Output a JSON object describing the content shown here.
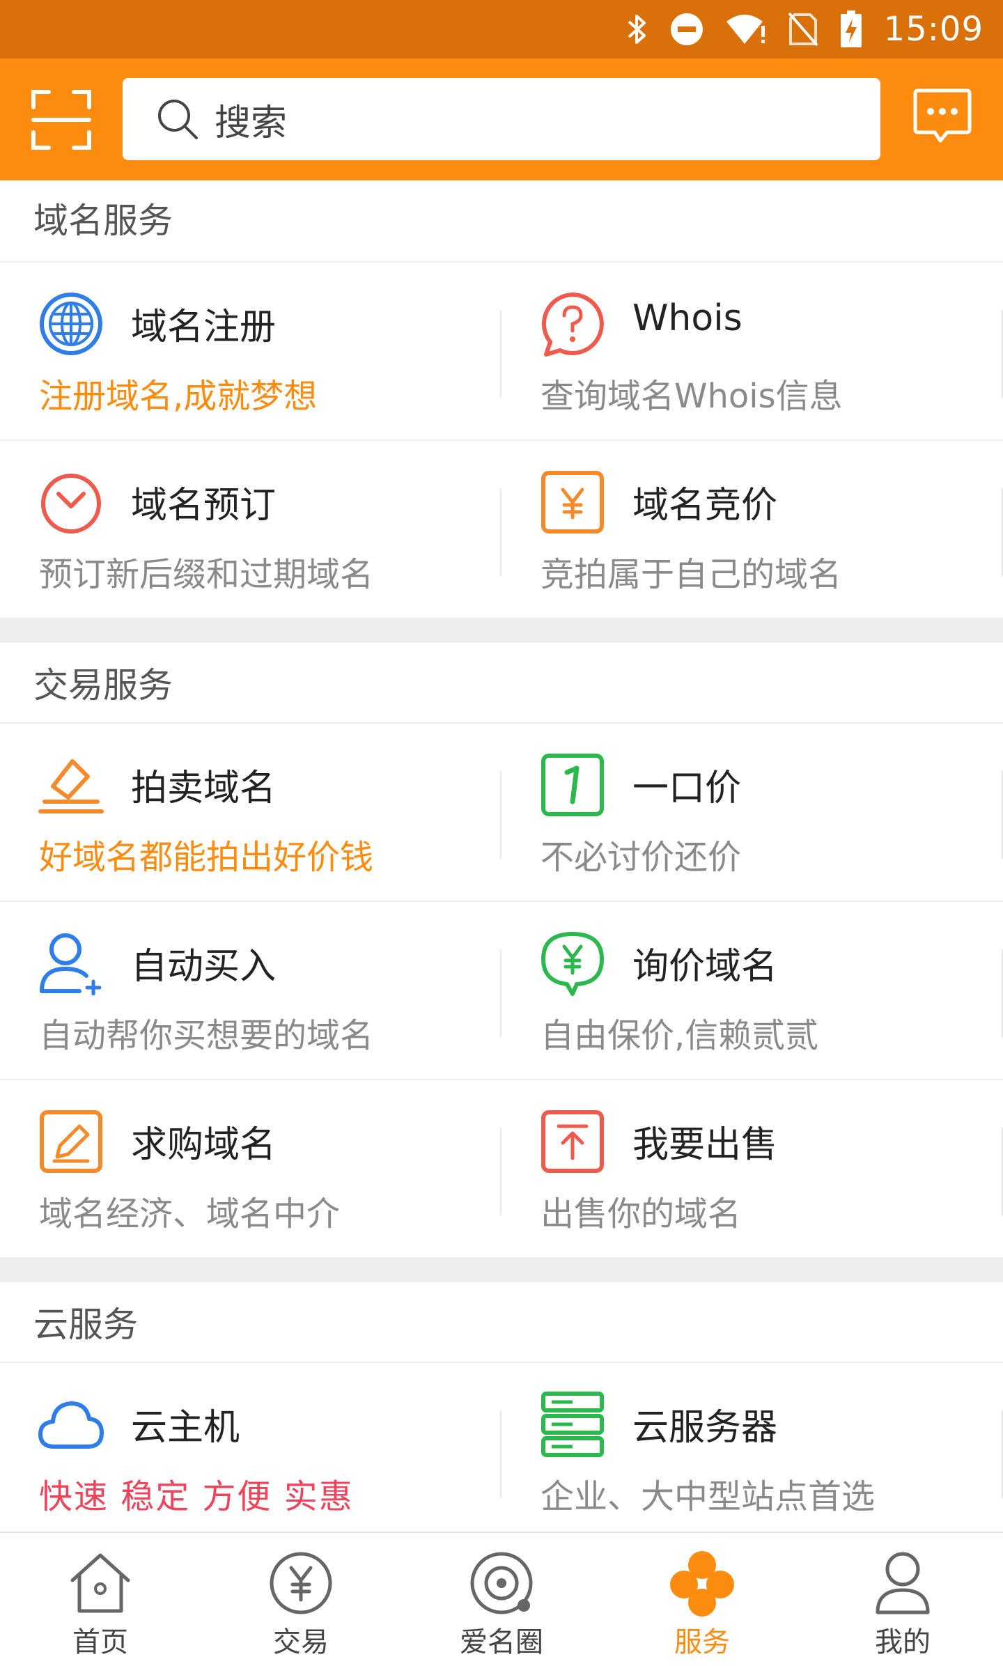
{
  "status_bar": {
    "time": "15:09"
  },
  "header": {
    "search_placeholder": "搜索"
  },
  "sections": {
    "domain": {
      "title": "域名服务",
      "items": [
        {
          "title": "域名注册",
          "desc": "注册域名,成就梦想"
        },
        {
          "title": "Whois",
          "desc": "查询域名Whois信息"
        },
        {
          "title": "域名预订",
          "desc": "预订新后缀和过期域名"
        },
        {
          "title": "域名竞价",
          "desc": "竞拍属于自己的域名"
        }
      ]
    },
    "trade": {
      "title": "交易服务",
      "items": [
        {
          "title": "拍卖域名",
          "desc": "好域名都能拍出好价钱"
        },
        {
          "title": "一口价",
          "desc": "不必讨价还价"
        },
        {
          "title": "自动买入",
          "desc": "自动帮你买想要的域名"
        },
        {
          "title": "询价域名",
          "desc": "自由保价,信赖贰贰"
        },
        {
          "title": "求购域名",
          "desc": "域名经济、域名中介"
        },
        {
          "title": "我要出售",
          "desc": "出售你的域名"
        }
      ]
    },
    "cloud": {
      "title": "云服务",
      "items": [
        {
          "title": "云主机",
          "desc": "快速 稳定 方便 实惠"
        },
        {
          "title": "云服务器",
          "desc": "企业、大中型站点首选"
        }
      ]
    }
  },
  "bottom_nav": [
    {
      "label": "首页"
    },
    {
      "label": "交易"
    },
    {
      "label": "爱名圈"
    },
    {
      "label": "服务"
    },
    {
      "label": "我的"
    }
  ],
  "colors": {
    "accent": "#fb8c10",
    "status_bar": "#d9700a"
  }
}
